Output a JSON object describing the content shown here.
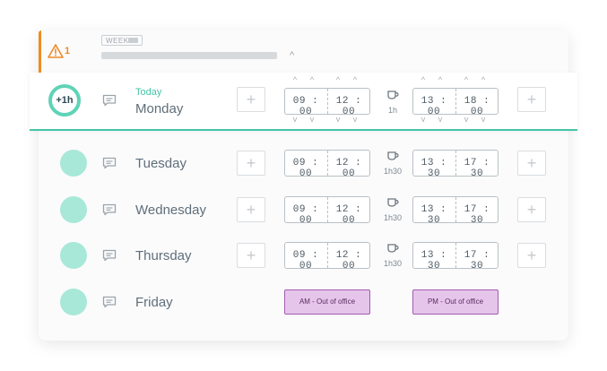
{
  "header": {
    "warning_count": "1",
    "week_label": "WEEK",
    "progress": 0.0,
    "collapse_icon": "chevron-up-icon"
  },
  "days": [
    {
      "today_label": "Today",
      "name": "Monday",
      "badge": "+1h",
      "morning": {
        "start": "09 : 00",
        "end": "12 : 00"
      },
      "break": "1h",
      "afternoon": {
        "start": "13 : 00",
        "end": "18 : 00"
      }
    },
    {
      "name": "Tuesday",
      "morning": {
        "start": "09 : 00",
        "end": "12 : 00"
      },
      "break": "1h30",
      "afternoon": {
        "start": "13 : 30",
        "end": "17 : 30"
      }
    },
    {
      "name": "Wednesday",
      "morning": {
        "start": "09 : 00",
        "end": "12 : 00"
      },
      "break": "1h30",
      "afternoon": {
        "start": "13 : 30",
        "end": "17 : 30"
      }
    },
    {
      "name": "Thursday",
      "morning": {
        "start": "09 : 00",
        "end": "12 : 00"
      },
      "break": "1h30",
      "afternoon": {
        "start": "13 : 30",
        "end": "17 : 30"
      }
    },
    {
      "name": "Friday",
      "morning_status": "AM - Out of office",
      "afternoon_status": "PM - Out of office"
    }
  ],
  "icons": {
    "plus": "+",
    "chevron_up": "^",
    "chevron_down": "v",
    "collapse": "^"
  },
  "colors": {
    "accent_orange": "#f08a24",
    "accent_teal": "#43c5a7",
    "avatar": "#a8e8d8",
    "ooo_fill": "#e6c5ea",
    "ooo_border": "#a35bb0"
  }
}
